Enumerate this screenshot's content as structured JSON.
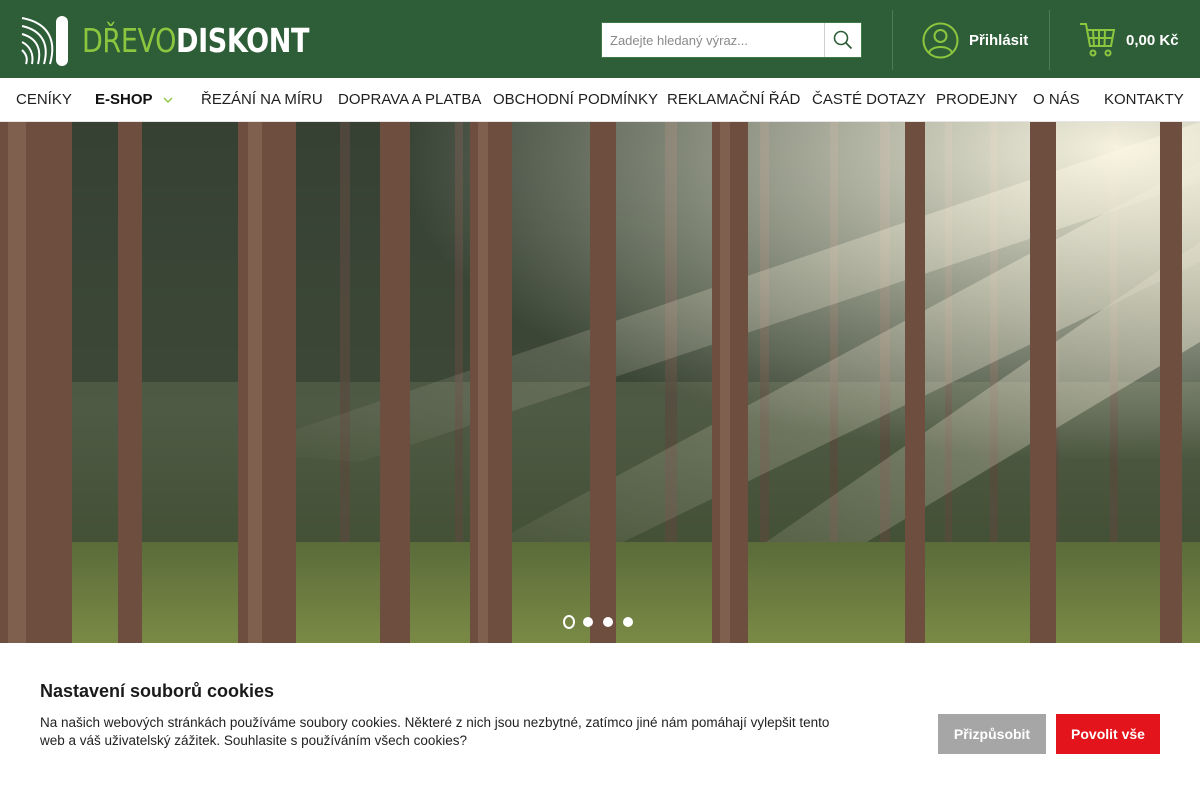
{
  "brand": {
    "name_part1": "DŘEVO",
    "name_part2": "DISKONT",
    "accent_color": "#8cc63f",
    "header_color": "#2e5e38"
  },
  "search": {
    "placeholder": "Zadejte hledaný výraz...",
    "value": "",
    "icon": "search-icon"
  },
  "account": {
    "login_label": "Přihlásit",
    "icon": "user-icon"
  },
  "cart": {
    "total": "0,00 Kč",
    "icon": "cart-icon"
  },
  "nav": {
    "items": [
      {
        "label": "CENÍKY"
      },
      {
        "label": "E-SHOP",
        "active": true,
        "has_dropdown": true
      },
      {
        "label": "ŘEZÁNÍ NA MÍRU"
      },
      {
        "label": "DOPRAVA A PLATBA"
      },
      {
        "label": "OBCHODNÍ PODMÍNKY"
      },
      {
        "label": "REKLAMAČNÍ ŘÁD"
      },
      {
        "label": "ČASTÉ DOTAZY"
      },
      {
        "label": "PRODEJNY"
      },
      {
        "label": "O NÁS"
      },
      {
        "label": "KONTAKTY"
      }
    ]
  },
  "slider": {
    "slide_count": 4,
    "active_index": 0
  },
  "cookies": {
    "title": "Nastavení souborů cookies",
    "text": "Na našich webových stránkách používáme soubory cookies. Některé z nich jsou nezbytné, zatímco jiné nám pomáhají vylepšit tento web a váš uživatelský zážitek. Souhlasite s používáním všech cookies?",
    "customize_label": "Přizpůsobit",
    "allow_label": "Povolit vše",
    "allow_color": "#e3141b",
    "customize_color": "#a6a6a6"
  }
}
